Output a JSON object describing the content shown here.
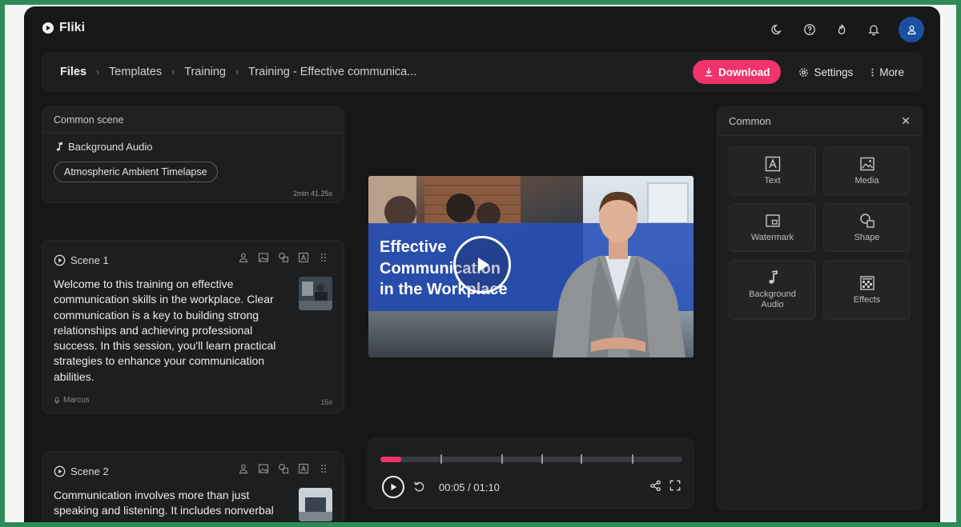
{
  "app": {
    "name": "Fliki"
  },
  "breadcrumb": {
    "items": [
      "Files",
      "Templates",
      "Training",
      "Training - Effective communica..."
    ]
  },
  "actions": {
    "download_label": "Download",
    "settings_label": "Settings",
    "more_label": "More"
  },
  "common_scene": {
    "title": "Common scene",
    "audio_label": "Background Audio",
    "audio_track": "Atmospheric Ambient Timelapse",
    "duration": "2min 41.25s"
  },
  "scenes": [
    {
      "label": "Scene 1",
      "text": "Welcome to this training on effective communication skills in the workplace. Clear communication is a key to building strong relationships and achieving professional success. In this session, you'll learn practical strategies to enhance your communication abilities.",
      "voice": "Marcus",
      "duration": "15s"
    },
    {
      "label": "Scene 2",
      "text": "Communication involves more than just speaking and listening. It includes nonverbal"
    }
  ],
  "video": {
    "title_line1": "Effective",
    "title_line2": "Communication",
    "title_line3": "in the Workplace"
  },
  "player": {
    "time": "00:05 / 01:10",
    "progress": 0.07,
    "scene_markers": [
      0.2,
      0.4,
      0.533,
      0.664,
      0.833
    ]
  },
  "common_panel": {
    "title": "Common",
    "tiles": [
      "Text",
      "Media",
      "Watermark",
      "Shape",
      "Background Audio",
      "Effects"
    ]
  },
  "colors": {
    "accent": "#f0336b",
    "background": "#161718",
    "panel": "#1d1e20",
    "video_band": "#2650ba",
    "avatar": "#1c4fa0",
    "outer_frame": "#2e8b57"
  }
}
